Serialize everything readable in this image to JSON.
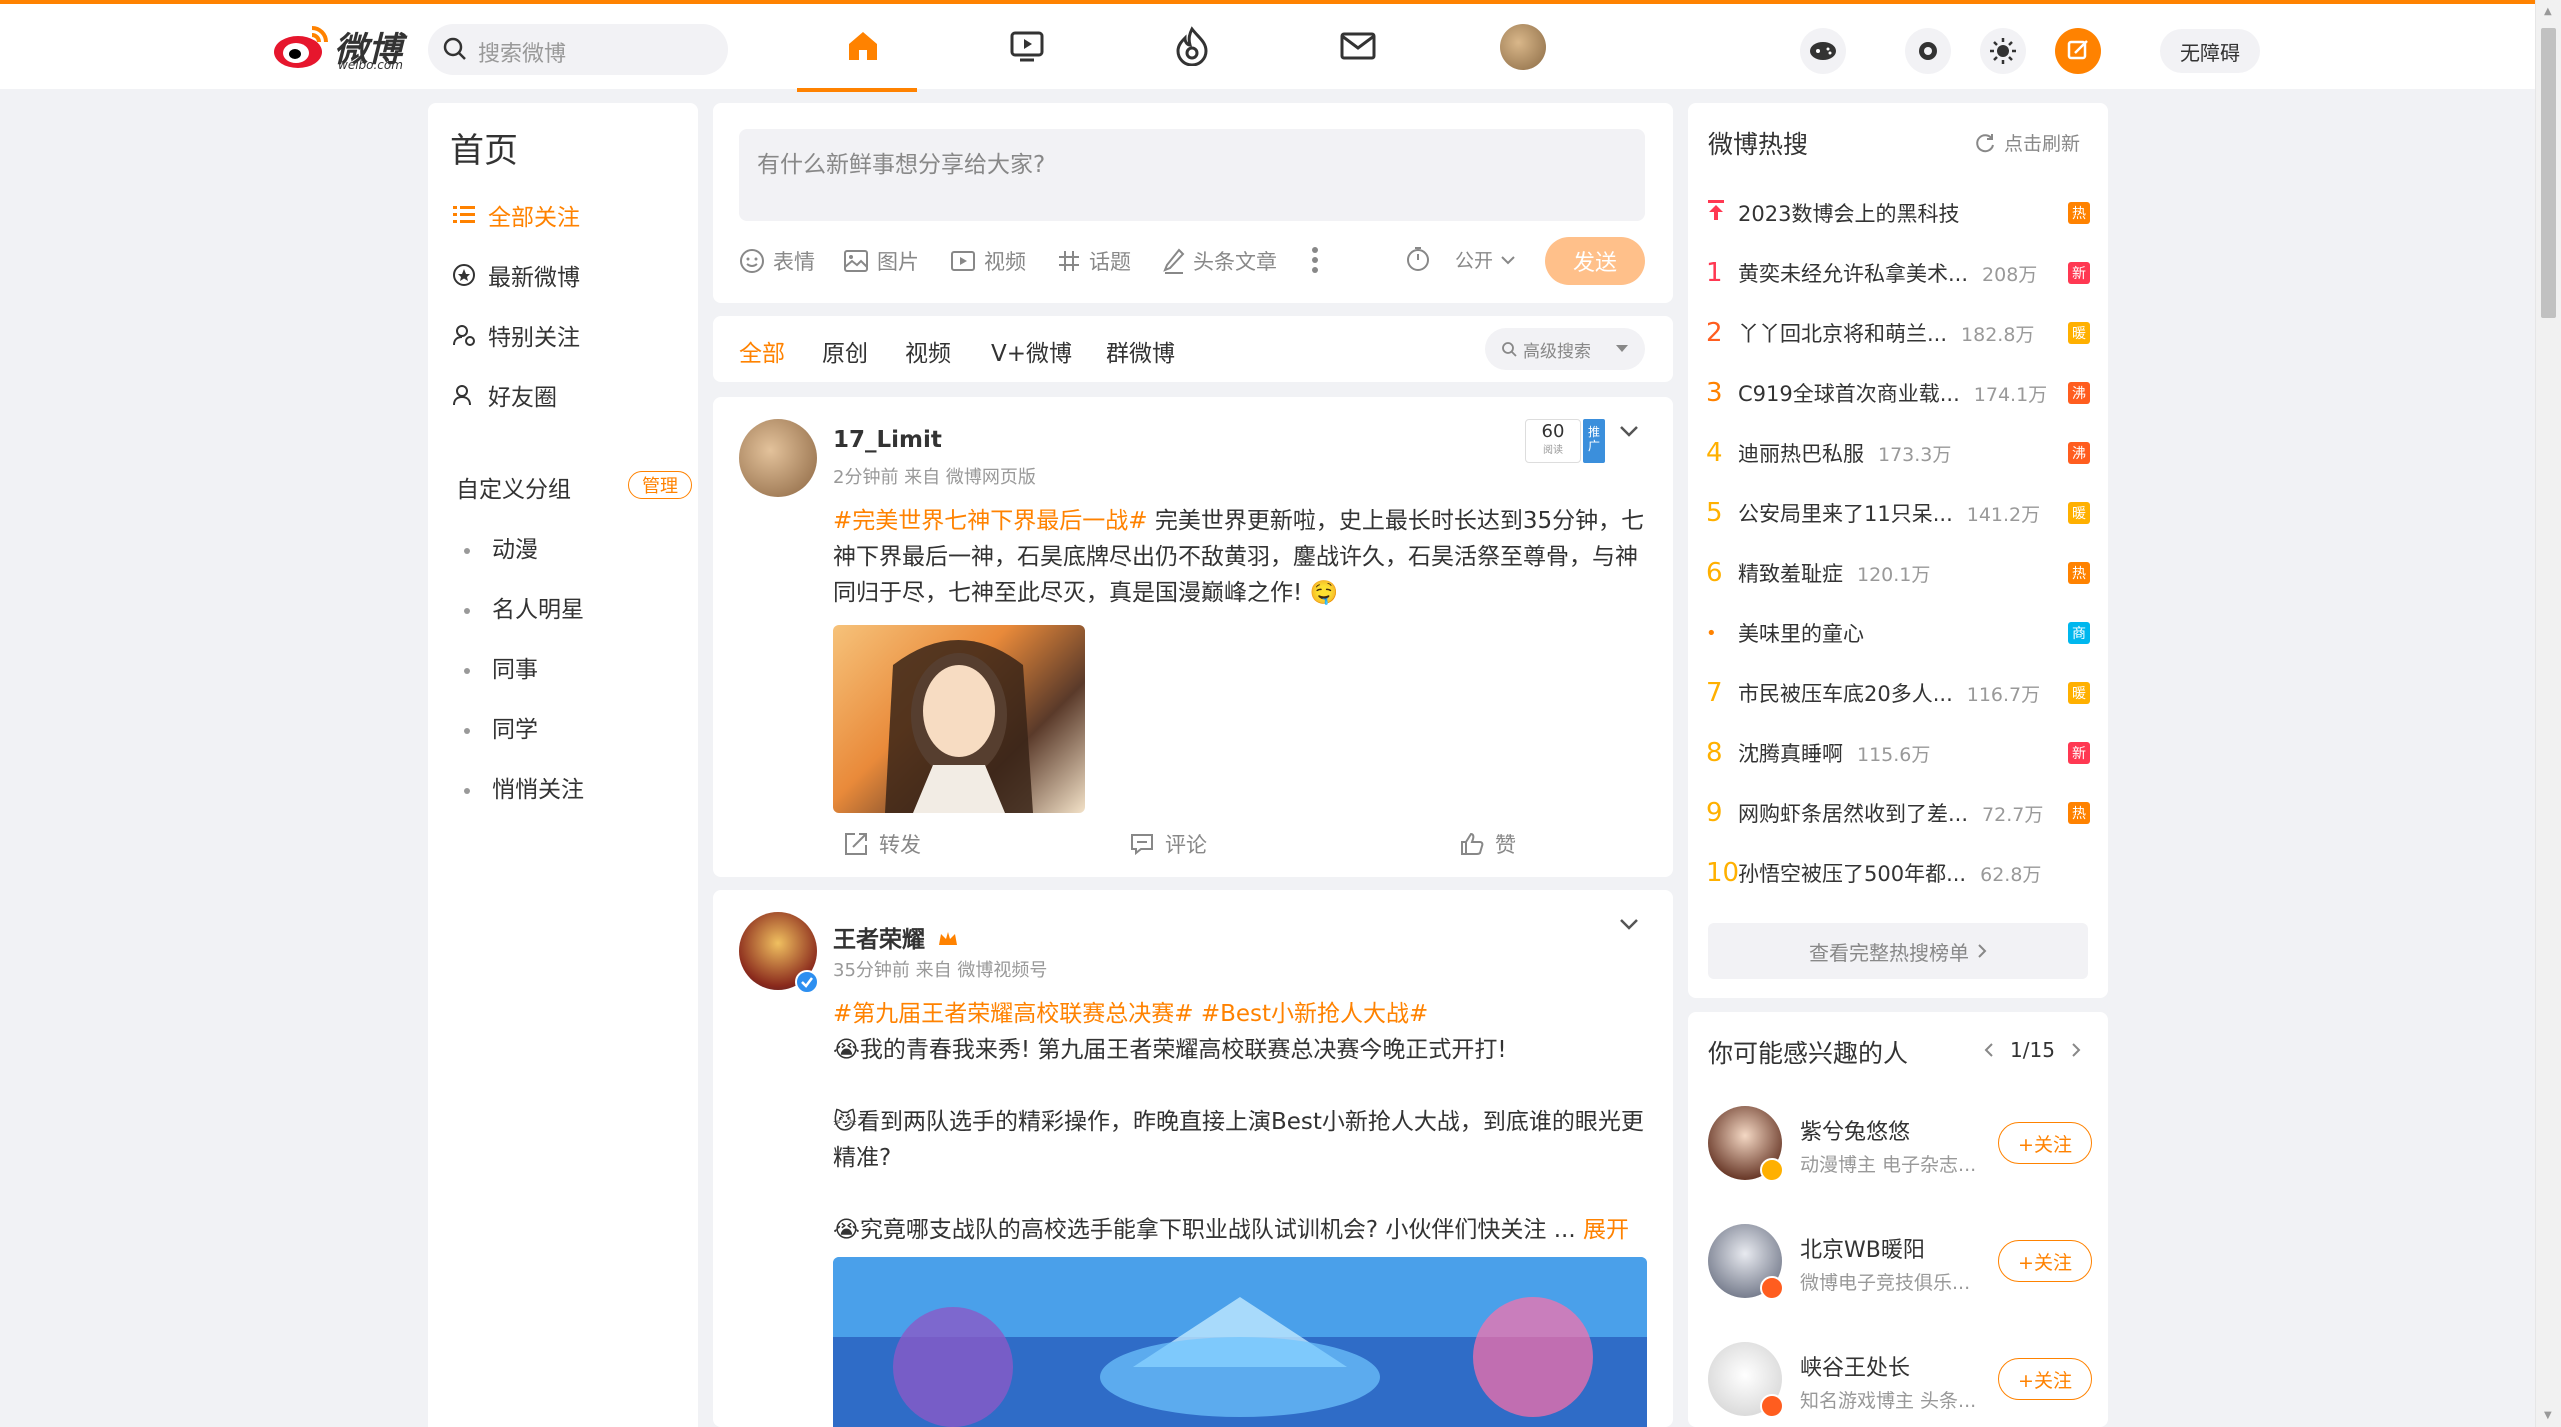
{
  "header": {
    "logo_name": "微博",
    "logo_sub": "weibo.com",
    "search_placeholder": "搜索微博",
    "accessibility_label": "无障碍"
  },
  "colors": {
    "accent": "#ff8200",
    "hot_red": "#ff3852",
    "new_red": "#ff3852",
    "warm": "#ffb000",
    "boil": "#ff5d1f",
    "biz": "#00b7ee"
  },
  "left": {
    "title": "首页",
    "nav": [
      "全部关注",
      "最新微博",
      "特别关注",
      "好友圈"
    ],
    "group_title": "自定义分组",
    "manage": "管理",
    "groups": [
      "动漫",
      "名人明星",
      "同事",
      "同学",
      "悄悄关注"
    ]
  },
  "composer": {
    "placeholder": "有什么新鲜事想分享给大家?",
    "tools": [
      "表情",
      "图片",
      "视频",
      "话题",
      "头条文章"
    ],
    "visibility": "公开",
    "send": "发送"
  },
  "tabs": {
    "items": [
      "全部",
      "原创",
      "视频",
      "V+微博",
      "群微博"
    ],
    "advanced": "高级搜索"
  },
  "posts": [
    {
      "author": "17_Limit",
      "meta": "2分钟前 来自 微博网页版",
      "reads": "60",
      "reads_label": "阅读",
      "promo": "推广",
      "tag": "#完美世界七神下界最后一战#",
      "text": " 完美世界更新啦，史上最长时长达到35分钟，七神下界最后一神，石昊底牌尽出仍不敌黄羽，鏖战许久，石昊活祭至尊骨，与神同归于尽，七神至此尽灭，真是国漫巅峰之作! 🤤",
      "actions": [
        "转发",
        "评论",
        "赞"
      ]
    },
    {
      "author": "王者荣耀",
      "meta": "35分钟前 来自 微博视频号",
      "tags": "#第九届王者荣耀高校联赛总决赛# #Best小新抢人大战#",
      "line1": "😭我的青春我来秀! 第九届王者荣耀高校联赛总决赛今晚正式开打!",
      "line2": "😼看到两队选手的精彩操作，昨晚直接上演Best小新抢人大战，到底谁的眼光更精准?",
      "line3": "😭究竟哪支战队的高校选手能拿下职业战队试训机会? 小伙伴们快关注 ...",
      "expand": "展开"
    }
  ],
  "hot": {
    "title": "微博热搜",
    "refresh": "点击刷新",
    "items": [
      {
        "rank": "",
        "title": "2023数博会上的黑科技",
        "num": "",
        "badge": "热"
      },
      {
        "rank": "1",
        "title": "黄奕未经允许私拿美术...",
        "num": "208万",
        "badge": "新"
      },
      {
        "rank": "2",
        "title": "丫丫回北京将和萌兰...",
        "num": "182.8万",
        "badge": "暖"
      },
      {
        "rank": "3",
        "title": "C919全球首次商业载...",
        "num": "174.1万",
        "badge": "沸"
      },
      {
        "rank": "4",
        "title": "迪丽热巴私服",
        "num": "173.3万",
        "badge": "沸"
      },
      {
        "rank": "5",
        "title": "公安局里来了11只呆...",
        "num": "141.2万",
        "badge": "暖"
      },
      {
        "rank": "6",
        "title": "精致羞耻症",
        "num": "120.1万",
        "badge": "热"
      },
      {
        "rank": "•",
        "title": "美味里的童心",
        "num": "",
        "badge": "商"
      },
      {
        "rank": "7",
        "title": "市民被压车底20多人...",
        "num": "116.7万",
        "badge": "暖"
      },
      {
        "rank": "8",
        "title": "沈腾真睡啊",
        "num": "115.6万",
        "badge": "新"
      },
      {
        "rank": "9",
        "title": "网购虾条居然收到了差...",
        "num": "72.7万",
        "badge": "热"
      },
      {
        "rank": "10",
        "title": "孙悟空被压了500年都...",
        "num": "62.8万",
        "badge": ""
      }
    ],
    "view_all": "查看完整热搜榜单"
  },
  "recommend": {
    "title": "你可能感兴趣的人",
    "page": "1/15",
    "follow": "+关注",
    "people": [
      {
        "name": "紫兮兔悠悠",
        "desc": "动漫博主 电子杂志..."
      },
      {
        "name": "北京WB暖阳",
        "desc": "微博电子竞技俱乐..."
      },
      {
        "name": "峡谷王处长",
        "desc": "知名游戏博主 头条..."
      }
    ]
  }
}
